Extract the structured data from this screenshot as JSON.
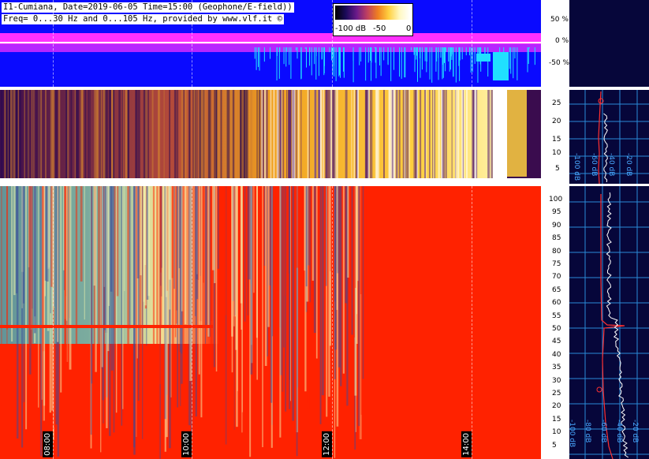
{
  "header": {
    "line1": "I1-Cumiana, Date=2019-06-05 Time=15:00 (Geophone/E-field))",
    "line2": "Freq= 0...30 Hz and 0...105 Hz, provided by www.vlf.it ©"
  },
  "colorbar": {
    "labels": [
      "-100 dB",
      "-50",
      "0"
    ]
  },
  "top_axis": {
    "labels": [
      "50 %",
      "0 %",
      "-50 %"
    ]
  },
  "mid_axis": {
    "labels": [
      "25",
      "20",
      "15",
      "10",
      "5"
    ]
  },
  "bot_axis": {
    "labels": [
      "100",
      "95",
      "90",
      "85",
      "80",
      "75",
      "70",
      "65",
      "60",
      "55",
      "50",
      "45",
      "40",
      "35",
      "30",
      "25",
      "20",
      "15",
      "10",
      "5"
    ]
  },
  "side_mid_labels": [
    "-100 dB",
    "-60 dB",
    "-40 dB",
    "-20 dB"
  ],
  "side_bot_labels": [
    "-100 dB",
    "-80 dB",
    "-60 dB",
    "-40 dB",
    "-20 dB"
  ],
  "time_labels": [
    "08:00",
    "10:00",
    "12:00",
    "14:00"
  ],
  "colors": {
    "top_bg": "#0a0aff",
    "magenta_band": "#ff30ff",
    "cyan": "#20e0ff",
    "spectrogram_red": "#ff2200",
    "side_bg": "#06063a",
    "grid_blue": "#2a8ad8"
  }
}
